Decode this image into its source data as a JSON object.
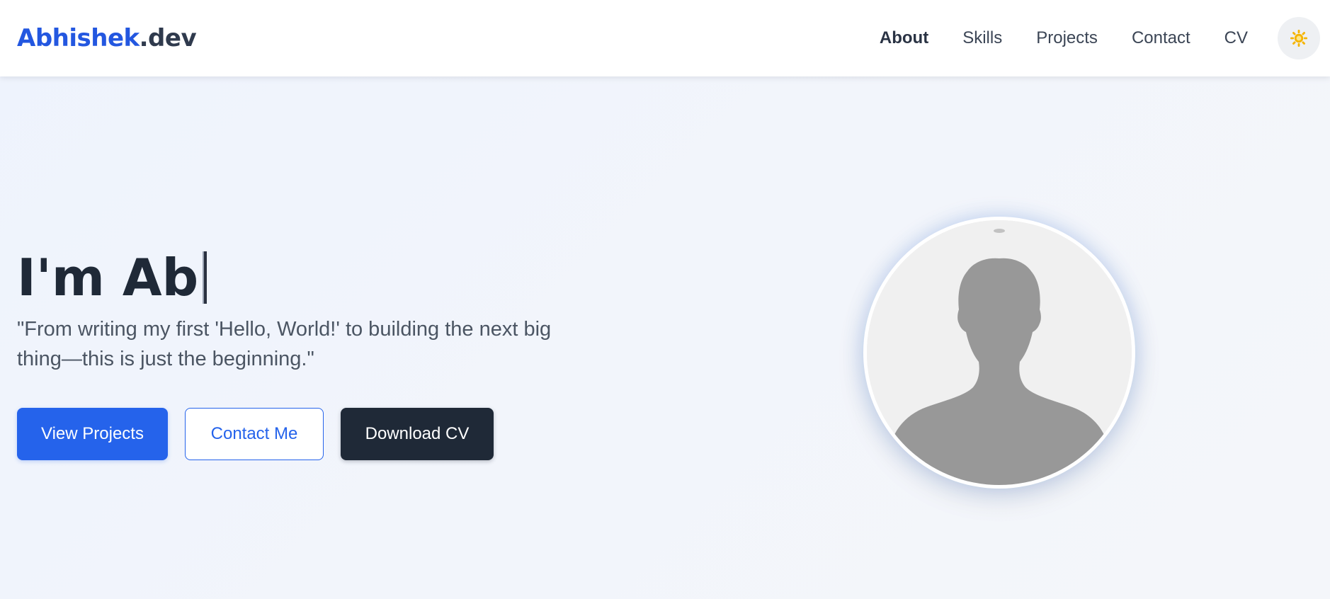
{
  "header": {
    "logo": {
      "name": "Abhishek",
      "suffix": ".dev"
    },
    "nav": [
      {
        "label": "About",
        "active": true
      },
      {
        "label": "Skills",
        "active": false
      },
      {
        "label": "Projects",
        "active": false
      },
      {
        "label": "Contact",
        "active": false
      },
      {
        "label": "CV",
        "active": false
      }
    ],
    "theme_toggle_icon": "sun-icon"
  },
  "hero": {
    "title": "I'm Ab",
    "quote": "\"From writing my first 'Hello, World!' to building the next big thing—this is just the beginning.\"",
    "buttons": {
      "view_projects": "View Projects",
      "contact_me": "Contact Me",
      "download_cv": "Download CV"
    },
    "avatar_icon": "person-silhouette-icon"
  },
  "colors": {
    "accent": "#2563eb",
    "dark": "#1f2937",
    "sun": "#f5b400"
  }
}
